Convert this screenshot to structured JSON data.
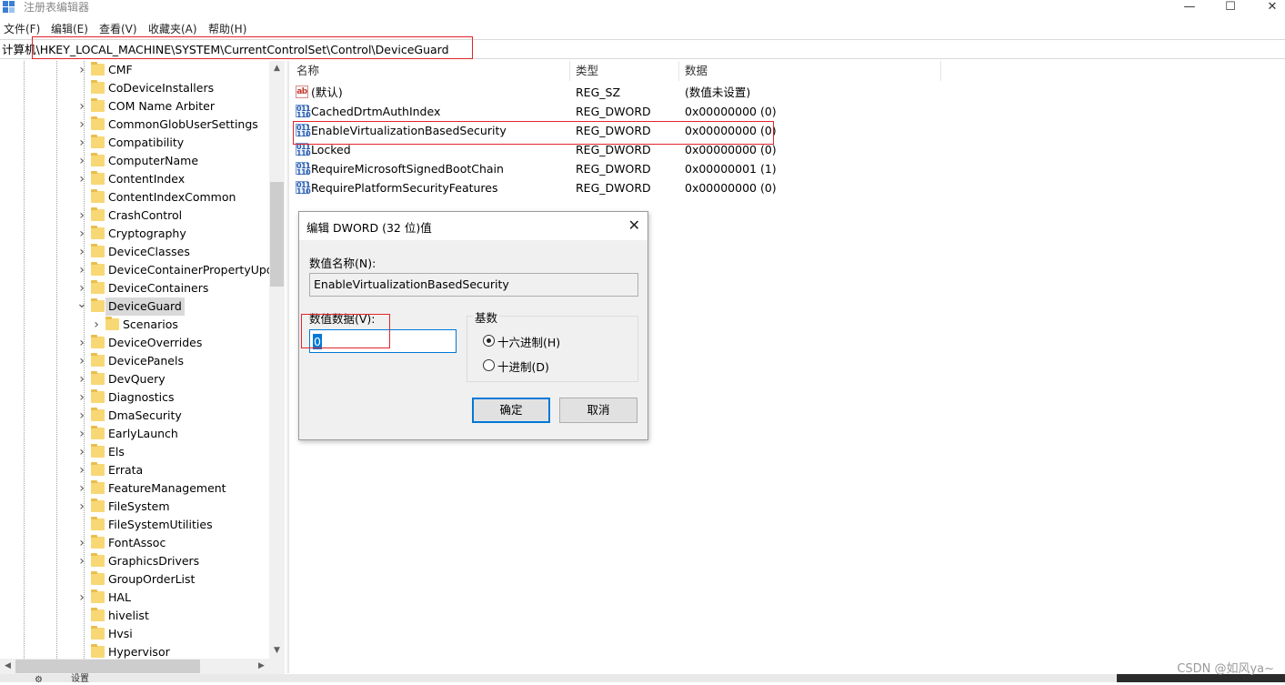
{
  "window": {
    "title": "注册表编辑器",
    "minimize": "—",
    "maximize": "☐",
    "close": "✕"
  },
  "menu": [
    "文件(F)",
    "编辑(E)",
    "查看(V)",
    "收藏夹(A)",
    "帮助(H)"
  ],
  "address": {
    "path": "计算机\\HKEY_LOCAL_MACHINE\\SYSTEM\\CurrentControlSet\\Control\\DeviceGuard"
  },
  "tree": {
    "items": [
      {
        "label": "CMF",
        "expanded": false,
        "selected": false,
        "level": 0
      },
      {
        "label": "CoDeviceInstallers",
        "expanded": false,
        "selected": false,
        "level": 0,
        "leaf": true
      },
      {
        "label": "COM Name Arbiter",
        "expanded": false,
        "selected": false,
        "level": 0
      },
      {
        "label": "CommonGlobUserSettings",
        "expanded": false,
        "selected": false,
        "level": 0
      },
      {
        "label": "Compatibility",
        "expanded": false,
        "selected": false,
        "level": 0
      },
      {
        "label": "ComputerName",
        "expanded": false,
        "selected": false,
        "level": 0
      },
      {
        "label": "ContentIndex",
        "expanded": false,
        "selected": false,
        "level": 0
      },
      {
        "label": "ContentIndexCommon",
        "expanded": false,
        "selected": false,
        "level": 0,
        "leaf": true
      },
      {
        "label": "CrashControl",
        "expanded": false,
        "selected": false,
        "level": 0
      },
      {
        "label": "Cryptography",
        "expanded": false,
        "selected": false,
        "level": 0
      },
      {
        "label": "DeviceClasses",
        "expanded": false,
        "selected": false,
        "level": 0
      },
      {
        "label": "DeviceContainerPropertyUpda",
        "expanded": false,
        "selected": false,
        "level": 0
      },
      {
        "label": "DeviceContainers",
        "expanded": false,
        "selected": false,
        "level": 0
      },
      {
        "label": "DeviceGuard",
        "expanded": true,
        "selected": true,
        "level": 0
      },
      {
        "label": "Scenarios",
        "expanded": false,
        "selected": false,
        "level": 1
      },
      {
        "label": "DeviceOverrides",
        "expanded": false,
        "selected": false,
        "level": 0
      },
      {
        "label": "DevicePanels",
        "expanded": false,
        "selected": false,
        "level": 0
      },
      {
        "label": "DevQuery",
        "expanded": false,
        "selected": false,
        "level": 0
      },
      {
        "label": "Diagnostics",
        "expanded": false,
        "selected": false,
        "level": 0
      },
      {
        "label": "DmaSecurity",
        "expanded": false,
        "selected": false,
        "level": 0
      },
      {
        "label": "EarlyLaunch",
        "expanded": false,
        "selected": false,
        "level": 0
      },
      {
        "label": "Els",
        "expanded": false,
        "selected": false,
        "level": 0
      },
      {
        "label": "Errata",
        "expanded": false,
        "selected": false,
        "level": 0
      },
      {
        "label": "FeatureManagement",
        "expanded": false,
        "selected": false,
        "level": 0
      },
      {
        "label": "FileSystem",
        "expanded": false,
        "selected": false,
        "level": 0
      },
      {
        "label": "FileSystemUtilities",
        "expanded": false,
        "selected": false,
        "level": 0,
        "leaf": true
      },
      {
        "label": "FontAssoc",
        "expanded": false,
        "selected": false,
        "level": 0
      },
      {
        "label": "GraphicsDrivers",
        "expanded": false,
        "selected": false,
        "level": 0
      },
      {
        "label": "GroupOrderList",
        "expanded": false,
        "selected": false,
        "level": 0,
        "leaf": true
      },
      {
        "label": "HAL",
        "expanded": false,
        "selected": false,
        "level": 0
      },
      {
        "label": "hivelist",
        "expanded": false,
        "selected": false,
        "level": 0,
        "leaf": true
      },
      {
        "label": "Hvsi",
        "expanded": false,
        "selected": false,
        "level": 0,
        "leaf": true
      },
      {
        "label": "Hypervisor",
        "expanded": false,
        "selected": false,
        "level": 0,
        "leaf": true
      }
    ]
  },
  "values_list": {
    "columns": [
      "名称",
      "类型",
      "数据"
    ],
    "rows": [
      {
        "icon": "string-value-icon",
        "name": "(默认)",
        "type": "REG_SZ",
        "data": "(数值未设置)"
      },
      {
        "icon": "dword-value-icon",
        "name": "CachedDrtmAuthIndex",
        "type": "REG_DWORD",
        "data": "0x00000000 (0)"
      },
      {
        "icon": "dword-value-icon",
        "name": "EnableVirtualizationBasedSecurity",
        "type": "REG_DWORD",
        "data": "0x00000000 (0)"
      },
      {
        "icon": "dword-value-icon",
        "name": "Locked",
        "type": "REG_DWORD",
        "data": "0x00000000 (0)"
      },
      {
        "icon": "dword-value-icon",
        "name": "RequireMicrosoftSignedBootChain",
        "type": "REG_DWORD",
        "data": "0x00000001 (1)"
      },
      {
        "icon": "dword-value-icon",
        "name": "RequirePlatformSecurityFeatures",
        "type": "REG_DWORD",
        "data": "0x00000000 (0)"
      }
    ]
  },
  "dialog": {
    "title": "编辑 DWORD (32 位)值",
    "name_label": "数值名称(N):",
    "name_value": "EnableVirtualizationBasedSecurity",
    "data_label": "数值数据(V):",
    "data_value": "0",
    "base_label": "基数",
    "radio_hex": "十六进制(H)",
    "radio_dec": "十进制(D)",
    "selected_base": "hex",
    "ok": "确定",
    "cancel": "取消",
    "close": "✕"
  },
  "taskbar": {
    "settings_text": "设置"
  },
  "watermark": "CSDN @如风ya~",
  "colors": {
    "highlight_border": "#e2242c",
    "accent": "#0078d7",
    "folder": "#f8d775"
  }
}
